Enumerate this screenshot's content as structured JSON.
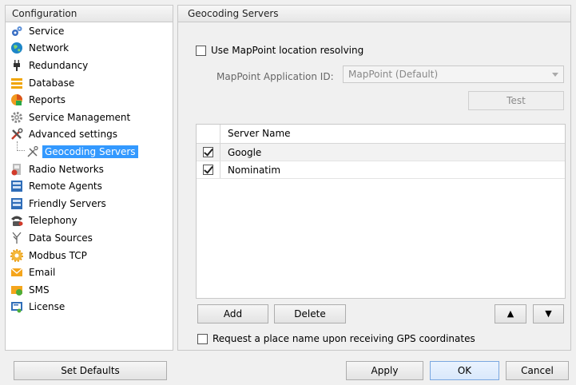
{
  "left": {
    "header": "Configuration",
    "items": [
      {
        "label": "Service",
        "icon": "gears-icon"
      },
      {
        "label": "Network",
        "icon": "globe-icon"
      },
      {
        "label": "Redundancy",
        "icon": "plug-icon"
      },
      {
        "label": "Database",
        "icon": "database-icon"
      },
      {
        "label": "Reports",
        "icon": "reports-icon"
      },
      {
        "label": "Service Management",
        "icon": "gear-icon"
      },
      {
        "label": "Advanced settings",
        "icon": "tools-icon"
      },
      {
        "label": "Geocoding Servers",
        "icon": "geocoding-icon"
      },
      {
        "label": "Radio Networks",
        "icon": "radio-icon"
      },
      {
        "label": "Remote Agents",
        "icon": "agents-icon"
      },
      {
        "label": "Friendly Servers",
        "icon": "servers-icon"
      },
      {
        "label": "Telephony",
        "icon": "phone-icon"
      },
      {
        "label": "Data Sources",
        "icon": "data-sources-icon"
      },
      {
        "label": "Modbus TCP",
        "icon": "modbus-icon"
      },
      {
        "label": "Email",
        "icon": "email-icon"
      },
      {
        "label": "SMS",
        "icon": "sms-icon"
      },
      {
        "label": "License",
        "icon": "license-icon"
      }
    ]
  },
  "right": {
    "header": "Geocoding Servers",
    "mappoint_label": "Use MapPoint location resolving",
    "mappoint_checked": false,
    "appid_label": "MapPoint Application ID:",
    "appid_value": "MapPoint (Default)",
    "test_button": "Test",
    "grid": {
      "column": "Server Name",
      "rows": [
        {
          "name": "Google",
          "checked": true
        },
        {
          "name": "Nominatim",
          "checked": true
        }
      ]
    },
    "add_button": "Add",
    "delete_button": "Delete",
    "up_button": "▲",
    "down_button": "▼",
    "request_label": "Request a place name upon receiving GPS coordinates",
    "request_checked": false
  },
  "footer": {
    "set_defaults": "Set Defaults",
    "apply": "Apply",
    "ok": "OK",
    "cancel": "Cancel"
  },
  "colors": {
    "selection": "#3399ff"
  }
}
